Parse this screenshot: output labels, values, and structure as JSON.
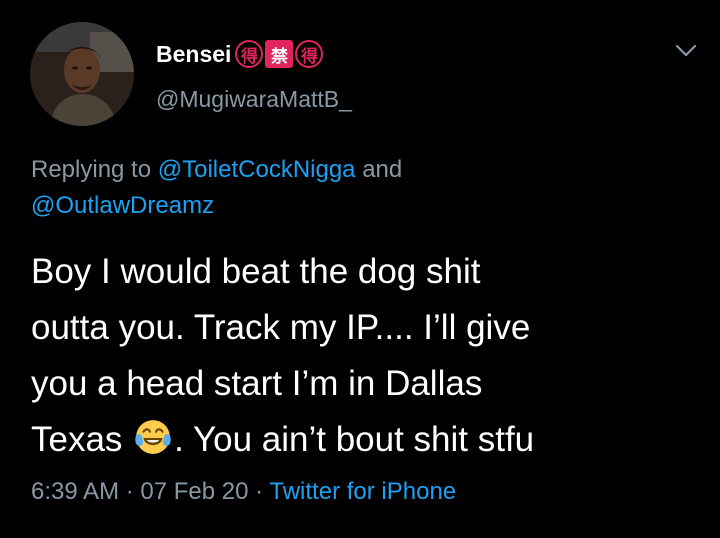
{
  "author": {
    "display_name": "Bensei",
    "name_glyphs": [
      "得",
      "禁",
      "得"
    ],
    "handle": "@MugiwaraMattB_"
  },
  "reply": {
    "prefix": "Replying to ",
    "mention_1": "@ToiletCockNigga",
    "joiner": " and",
    "mention_2": "@OutlawDreamz"
  },
  "tweet": {
    "line_1": "Boy I would beat the dog shit",
    "line_2": "outta you. Track my IP.... I’ll give",
    "line_3": "you a head start I’m in Dallas",
    "line_4_before_emoji": "Texas ",
    "emoji": "face-with-tears-of-joy",
    "line_4_after_emoji": ". You ain’t bout shit stfu"
  },
  "meta": {
    "time": "6:39 AM",
    "separator_1": " · ",
    "date": "07 Feb 20",
    "separator_2": " · ",
    "source": "Twitter for iPhone"
  },
  "icons": {
    "menu": "chevron-down-icon"
  },
  "colors": {
    "background": "#000000",
    "text": "#ffffff",
    "secondary": "#8899a6",
    "link": "#1da1f2",
    "glyph_accent": "#e0245e"
  }
}
